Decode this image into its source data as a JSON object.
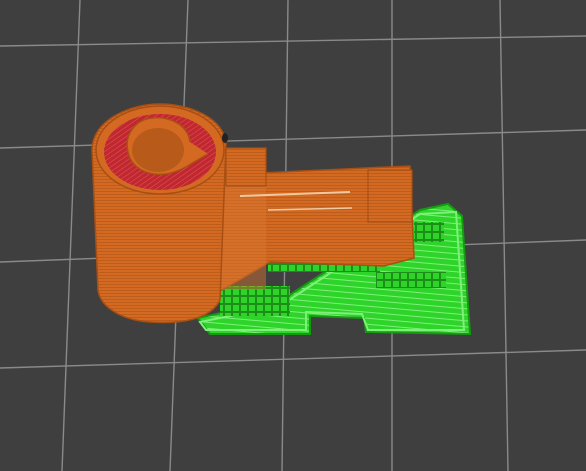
{
  "scene": {
    "description_icon": "3d-print-preview-viewport",
    "colors": {
      "background": "#3f3f3f",
      "grid_line": "#8a8a8a",
      "model_orange": "#d46a22",
      "model_orange_dark": "#a84f14",
      "model_orange_light": "#e8874a",
      "top_red": "#c0282e",
      "support_green": "#2fd42a",
      "support_green_dark": "#159a12",
      "support_green_light": "#7ef07a"
    }
  }
}
